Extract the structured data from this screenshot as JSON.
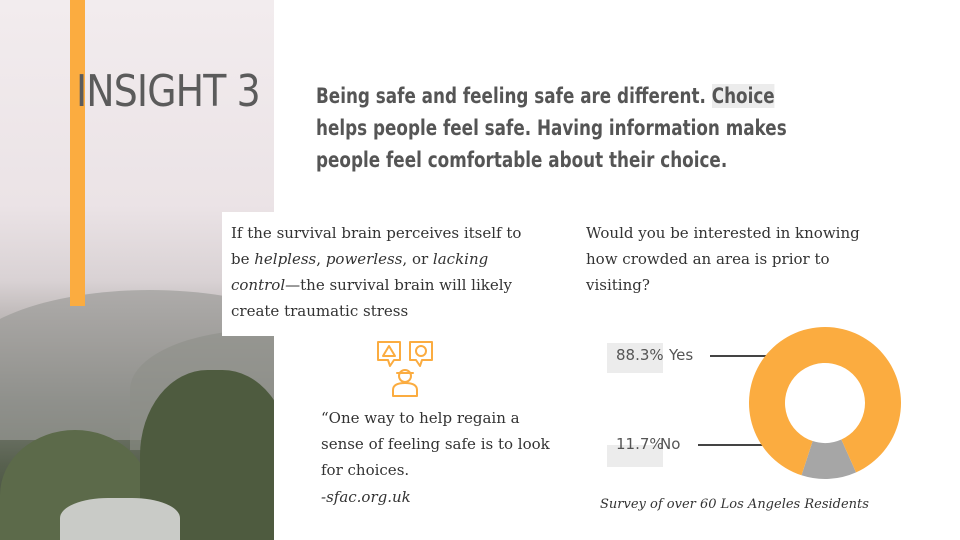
{
  "insight": {
    "title": "INSIGHT 3",
    "headline_part1": "Being safe and feeling safe are different. ",
    "headline_highlight": "Choice",
    "headline_part2": " helps people feel safe. Having information makes people feel comfortable about their choice."
  },
  "left_quote": {
    "line1": "If the survival brain perceives itself to be ",
    "em1": "helpless",
    "sep1": ", ",
    "em2": "powerless",
    "sep2": ", or ",
    "em3": "lacking control",
    "line2": "—the survival brain will likely create traumatic stress"
  },
  "choice_quote": {
    "text": "“One way to help regain a sense of feeling safe is to look for choices.",
    "source": "-sfac.org.uk"
  },
  "survey": {
    "question": "Would you be interested in knowing how crowded an area is prior to visiting?",
    "footnote": "Survey of over 60 Los Angeles Residents"
  },
  "colors": {
    "accent": "#fbac40",
    "no_slice": "#a6a6a6",
    "title_text": "#5b5b5b"
  },
  "chart_data": {
    "type": "pie",
    "donut": true,
    "categories": [
      "Yes",
      "No"
    ],
    "values": [
      88.3,
      11.7
    ],
    "labels": [
      "88.3%",
      "11.7%"
    ],
    "colors": [
      "#fbac40",
      "#a6a6a6"
    ]
  }
}
